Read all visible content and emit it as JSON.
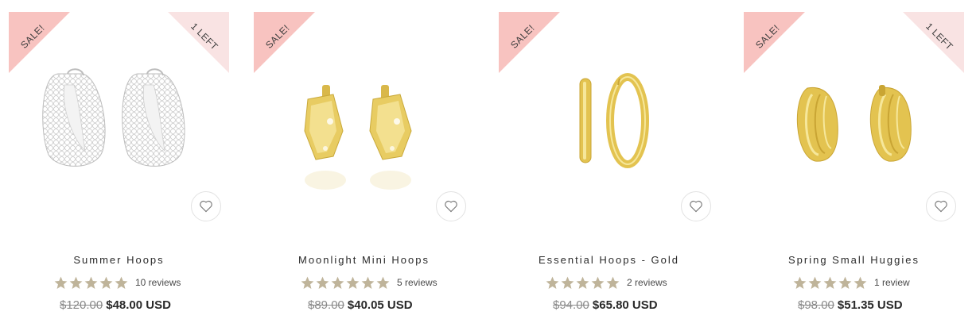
{
  "products": [
    {
      "name": "Summer Hoops",
      "badge_sale": "SALE!",
      "badge_stock": "1 LEFT",
      "rating_stars": 5,
      "reviews": "10 reviews",
      "old_price": "$120.00",
      "new_price": "$48.00 USD",
      "image_style": "silver-bubble-hoops"
    },
    {
      "name": "Moonlight Mini Hoops",
      "badge_sale": "SALE!",
      "badge_stock": "",
      "rating_stars": 5,
      "reviews": "5 reviews",
      "old_price": "$89.00",
      "new_price": "$40.05 USD",
      "image_style": "gold-faceted-mini-hoops"
    },
    {
      "name": "Essential Hoops - Gold",
      "badge_sale": "SALE!",
      "badge_stock": "",
      "rating_stars": 5,
      "reviews": "2 reviews",
      "old_price": "$94.00",
      "new_price": "$65.80 USD",
      "image_style": "gold-plain-hoops"
    },
    {
      "name": "Spring Small Huggies",
      "badge_sale": "SALE!",
      "badge_stock": "1 LEFT",
      "rating_stars": 5,
      "reviews": "1 review",
      "old_price": "$98.00",
      "new_price": "$51.35 USD",
      "image_style": "gold-ribbed-huggies"
    }
  ],
  "colors": {
    "sale_badge": "#f8c3c0",
    "stock_badge": "#f9e3e3",
    "star": "#bfb49a",
    "gold": "#e3c350",
    "silver": "#d9d9d9"
  },
  "icons": {
    "wishlist": "heart-outline-icon",
    "rating": "star-icon"
  }
}
